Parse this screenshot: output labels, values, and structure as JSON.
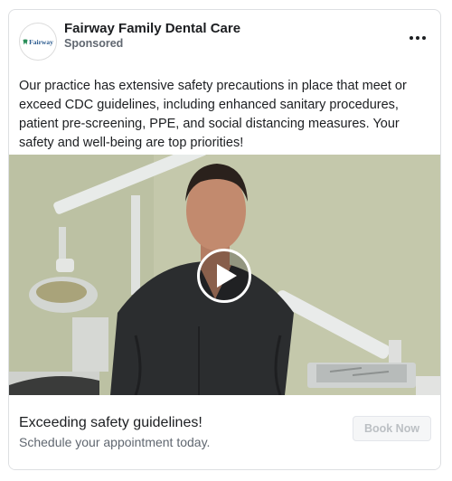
{
  "ad": {
    "page_name": "Fairway Family Dental Care",
    "sponsored_label": "Sponsored",
    "avatar_text": "Fairway",
    "more_icon": "more-horizontal-icon",
    "body_text": "Our practice has extensive safety precautions in place that meet or exceed CDC guidelines, including enhanced sanitary procedures, patient pre-screening, PPE, and social distancing measures. Your safety and well-being are top priorities!",
    "media": {
      "type": "video",
      "play_icon": "play-icon"
    },
    "headline": "Exceeding safety guidelines!",
    "description": "Schedule your appointment today.",
    "cta_label": "Book Now"
  },
  "colors": {
    "text_primary": "#1c1e21",
    "text_secondary": "#606770",
    "border": "#dddfe2",
    "cta_disabled_text": "#bcc0c4",
    "brand_logo": "#2b5b8f"
  }
}
